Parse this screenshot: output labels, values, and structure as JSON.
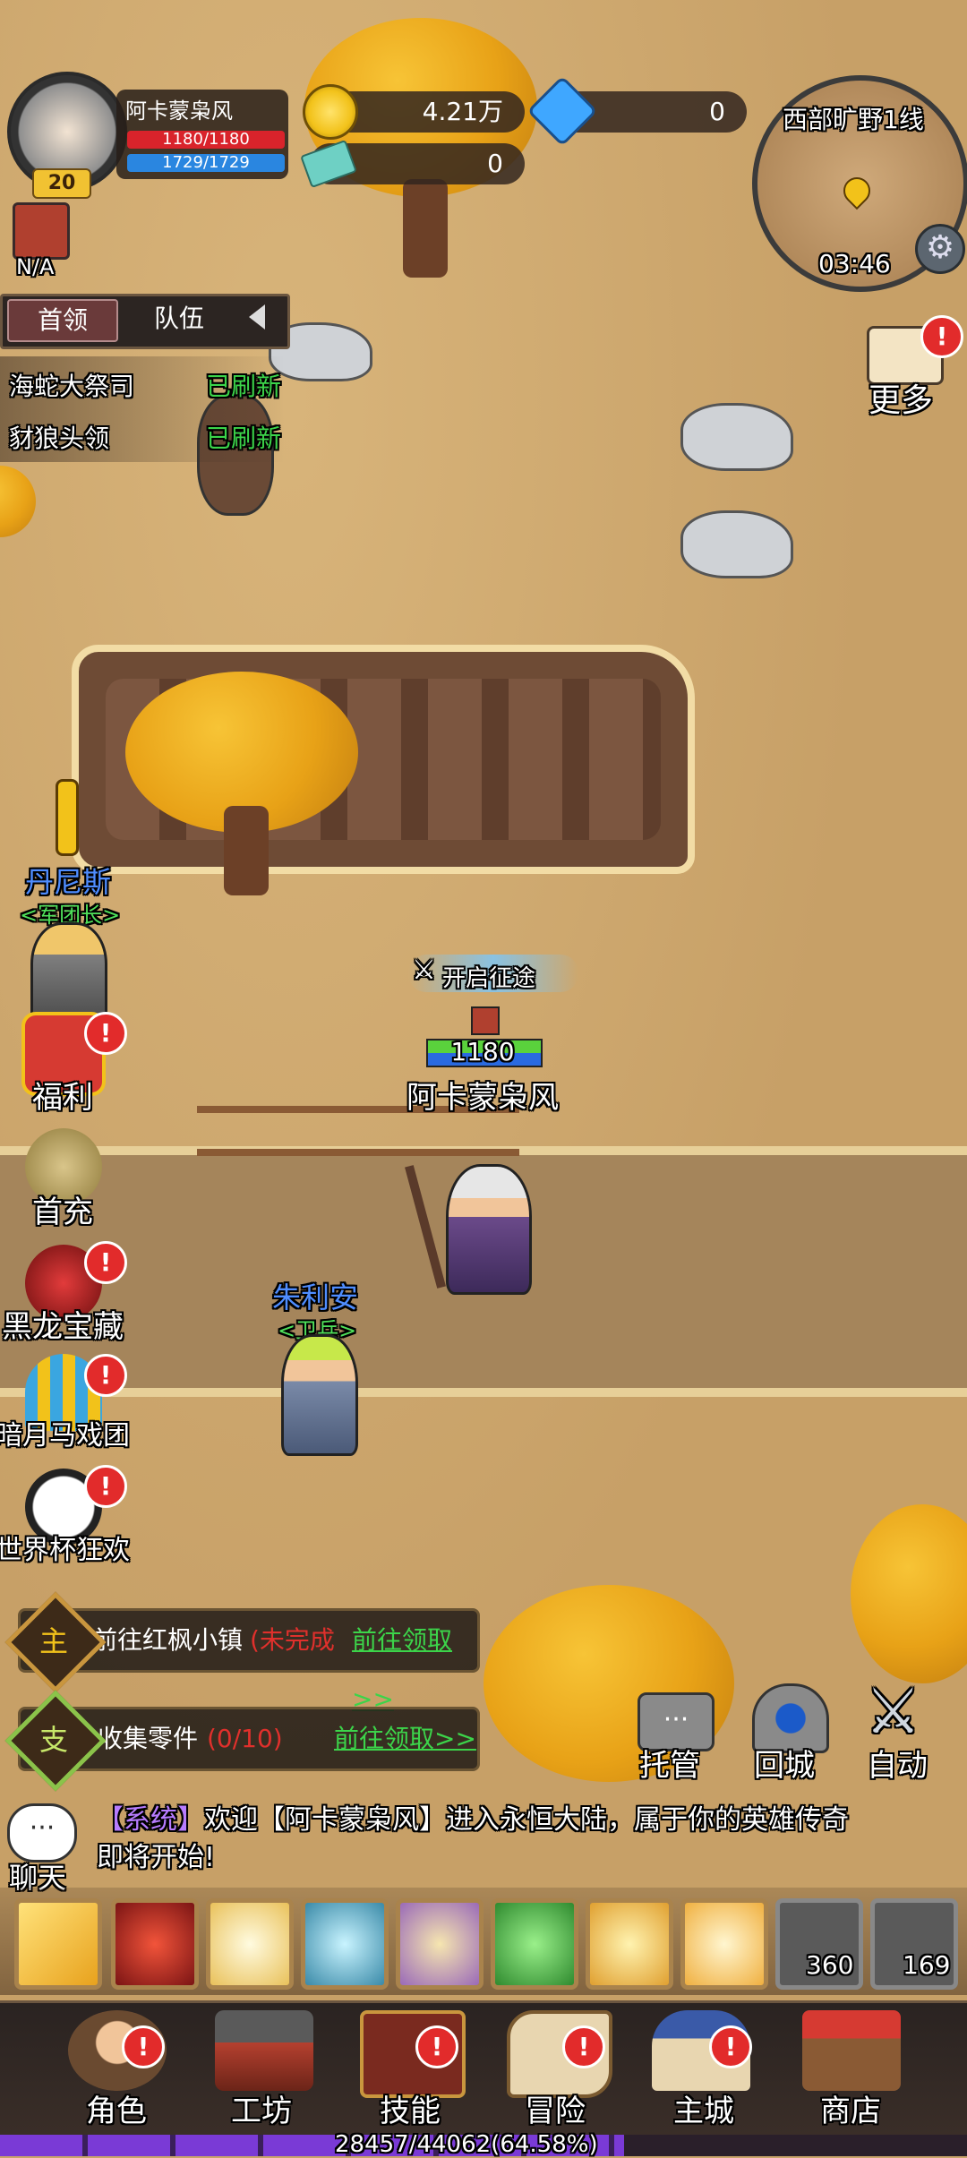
{
  "player": {
    "name": "阿卡蒙枭风",
    "level": "20",
    "hp": "1180/1180",
    "mp": "1729/1729",
    "mount_label": "N/A"
  },
  "resources": {
    "gold": "4.21万",
    "gems": "0",
    "tickets": "0"
  },
  "minimap": {
    "zone": "西部旷野1线",
    "time": "03:46",
    "more_label": "更多"
  },
  "tabs": [
    {
      "label": "首领"
    },
    {
      "label": "队伍"
    }
  ],
  "bosses": [
    {
      "name": "海蛇大祭司",
      "status": "已刷新"
    },
    {
      "name": "豺狼头领",
      "status": "已刷新"
    }
  ],
  "npcs": {
    "dennis": {
      "name": "丹尼斯",
      "title": "<军团长>"
    },
    "julian": {
      "name": "朱利安",
      "title": "<卫兵>"
    }
  },
  "hero": {
    "name": "阿卡蒙枭风",
    "hp": "1180",
    "journey_label": "开启征途"
  },
  "side_menu": [
    {
      "label": "福利",
      "badge": "!"
    },
    {
      "label": "首充"
    },
    {
      "label": "黑龙宝藏",
      "badge": "!"
    },
    {
      "label": "暗月马戏团",
      "badge": "!"
    },
    {
      "label": "世界杯狂欢",
      "badge": "!"
    }
  ],
  "quests": [
    {
      "type": "主",
      "text": "前往红枫小镇",
      "status": "(未完成",
      "action": "前往领取>>"
    },
    {
      "type": "支",
      "text": "收集零件",
      "status": "(0/10)",
      "action": "前往领取>>"
    }
  ],
  "actions": [
    {
      "label": "托管"
    },
    {
      "label": "回城"
    },
    {
      "label": "自动"
    }
  ],
  "chat": {
    "label": "聊天",
    "tag": "【系统】",
    "message": "欢迎【阿卡蒙枭风】进入永恒大陆，属于你的英雄传奇即将开始!"
  },
  "consumables": [
    {
      "count": "360"
    },
    {
      "count": "169"
    }
  ],
  "skills": [
    "lightning-skill",
    "skull-skill",
    "shield-skill",
    "crystal-shield-skill",
    "vortex-skill",
    "hand-skill",
    "crown-skill",
    "burst-skill"
  ],
  "nav": [
    {
      "label": "角色",
      "badge": "!"
    },
    {
      "label": "工坊"
    },
    {
      "label": "技能",
      "badge": "!"
    },
    {
      "label": "冒险",
      "badge": "!"
    },
    {
      "label": "主城",
      "badge": "!"
    },
    {
      "label": "商店"
    }
  ],
  "exp": {
    "text": "28457/44062(64.58%)",
    "fraction": 0.6458
  },
  "colors": {
    "hp": "#d9232b",
    "mp": "#2a86e0",
    "gold": "#f2c21a",
    "gem": "#3fa7ff",
    "quest_red": "#e0302c",
    "quest_green": "#3cd44a",
    "badge": "#e22b2b",
    "npc_name": "#4f8dff",
    "npc_title": "#4fe05a"
  }
}
